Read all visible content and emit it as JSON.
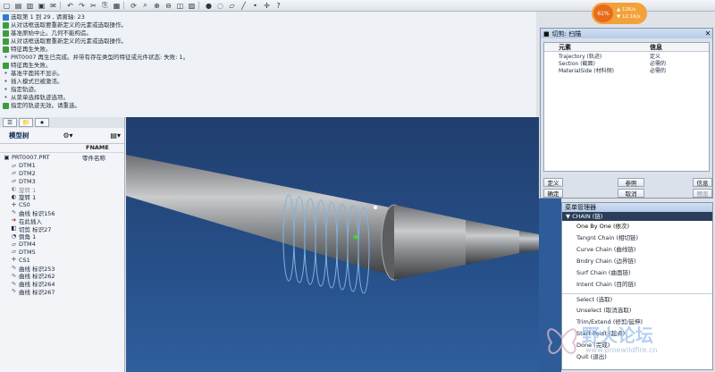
{
  "toolbar": {
    "icons": [
      "new-icon",
      "open-icon",
      "save-icon",
      "print-icon",
      "email-icon",
      "undo-icon",
      "redo-icon",
      "cut-icon",
      "copy-icon",
      "paste-icon",
      "regen-icon",
      "find-icon",
      "zoom-in-icon",
      "zoom-out-icon",
      "refit-icon",
      "repaint-icon",
      "shading-icon",
      "wireframe-icon",
      "datum-plane-icon",
      "datum-axis-icon",
      "datum-point-icon",
      "csys-icon",
      "help-icon"
    ]
  },
  "gauge": {
    "percent": "61%",
    "up": "12K/s",
    "down": "12.1K/s"
  },
  "messages": [
    {
      "icon": "info",
      "text": "选取第 1 到 29 , 请离轴:    23"
    },
    {
      "icon": "ok",
      "text": "从对话框选取要重新定义的元素或选取操作。"
    },
    {
      "icon": "ok",
      "text": "基准原始中止。几何不能构造。"
    },
    {
      "icon": "ok",
      "text": "从对话框选取要重新定义的元素或选取操作。"
    },
    {
      "icon": "ok",
      "text": "特征再生失败。"
    },
    {
      "icon": "dot",
      "text": "PRT0007 再生已完成。并带有存在类型的特征或元件状态: 失败: 1。"
    },
    {
      "icon": "ok",
      "text": "特征再生失败。"
    },
    {
      "icon": "dot",
      "text": "基准平面将不显示。"
    },
    {
      "icon": "dot",
      "text": "插入模式已被激活。"
    },
    {
      "icon": "dot",
      "text": "指定轨迹。"
    },
    {
      "icon": "dot",
      "text": "从菜单选择轨迹选项。"
    },
    {
      "icon": "ok",
      "text": "指定的轨迹无效。请重选。"
    }
  ],
  "sidebar": {
    "title": "模型树",
    "col1": "",
    "col2": "FNAME",
    "rows": [
      {
        "indent": 0,
        "icon": "part",
        "label": "PRT0007.PRT",
        "col2": "零件名称"
      },
      {
        "indent": 1,
        "icon": "plane",
        "label": "DTM1",
        "col2": ""
      },
      {
        "indent": 1,
        "icon": "plane",
        "label": "DTM2",
        "col2": ""
      },
      {
        "indent": 1,
        "icon": "plane",
        "label": "DTM3",
        "col2": ""
      },
      {
        "indent": 1,
        "icon": "feat",
        "label": "旋转 1",
        "col2": ""
      },
      {
        "indent": 1,
        "icon": "feat",
        "label": "旋转 1",
        "col2": ""
      },
      {
        "indent": 1,
        "icon": "csys",
        "label": "CS0",
        "col2": ""
      },
      {
        "indent": 1,
        "icon": "curve",
        "label": "曲线 标识156",
        "col2": ""
      },
      {
        "indent": 1,
        "icon": "insert",
        "label": "在此插入",
        "col2": ""
      },
      {
        "indent": 1,
        "icon": "cut",
        "label": "切剪 标识27",
        "col2": ""
      },
      {
        "indent": 1,
        "icon": "round",
        "label": "倒角 1",
        "col2": ""
      },
      {
        "indent": 1,
        "icon": "plane",
        "label": "DTM4",
        "col2": ""
      },
      {
        "indent": 1,
        "icon": "plane",
        "label": "DTM5",
        "col2": ""
      },
      {
        "indent": 1,
        "icon": "csys",
        "label": "CS1",
        "col2": ""
      },
      {
        "indent": 1,
        "icon": "curve",
        "label": "曲线 标识253",
        "col2": ""
      },
      {
        "indent": 1,
        "icon": "curve",
        "label": "曲线 标识262",
        "col2": ""
      },
      {
        "indent": 1,
        "icon": "curve",
        "label": "曲线 标识264",
        "col2": ""
      },
      {
        "indent": 1,
        "icon": "curve",
        "label": "曲线 标识267",
        "col2": ""
      }
    ]
  },
  "dialog": {
    "title": "切剪: 扫描",
    "col_element": "元素",
    "col_info": "信息",
    "rows": [
      {
        "element": "Trajectory (轨迹)",
        "info": "定义"
      },
      {
        "element": "Section (截面)",
        "info": "必需的"
      },
      {
        "element": "MaterialSide (材料侧)",
        "info": "必需的"
      }
    ],
    "buttons": {
      "define": "定义",
      "ref": "参照",
      "info": "信息",
      "ok": "确定",
      "cancel": "取消",
      "preview": "预览"
    }
  },
  "menu": {
    "title": "菜单管理器",
    "header": "▼ CHAIN (链)",
    "items": [
      {
        "label": "One By One (依次)",
        "selected": true
      },
      {
        "label": "Tangnt Chain (相切链)"
      },
      {
        "label": "Curve Chain (曲线链)"
      },
      {
        "label": "Bndry Chain (边界链)"
      },
      {
        "label": "Surf Chain (曲面链)"
      },
      {
        "label": "Intent Chain (目的链)"
      },
      {
        "label": "Select (选取)",
        "gap": true
      },
      {
        "label": "Unselect (取消选取)"
      },
      {
        "label": "Trim/Extend (修剪/延伸)"
      },
      {
        "label": "Start Point (起点)"
      },
      {
        "label": "Done (完成)"
      },
      {
        "label": "Quit (退出)"
      }
    ]
  },
  "watermark": {
    "text": "野火论坛",
    "url": "www.proewildfire.cn"
  },
  "colors": {
    "viewport": "#26508a",
    "menu_header": "#2b3d58",
    "gauge": "#f3a23a"
  }
}
